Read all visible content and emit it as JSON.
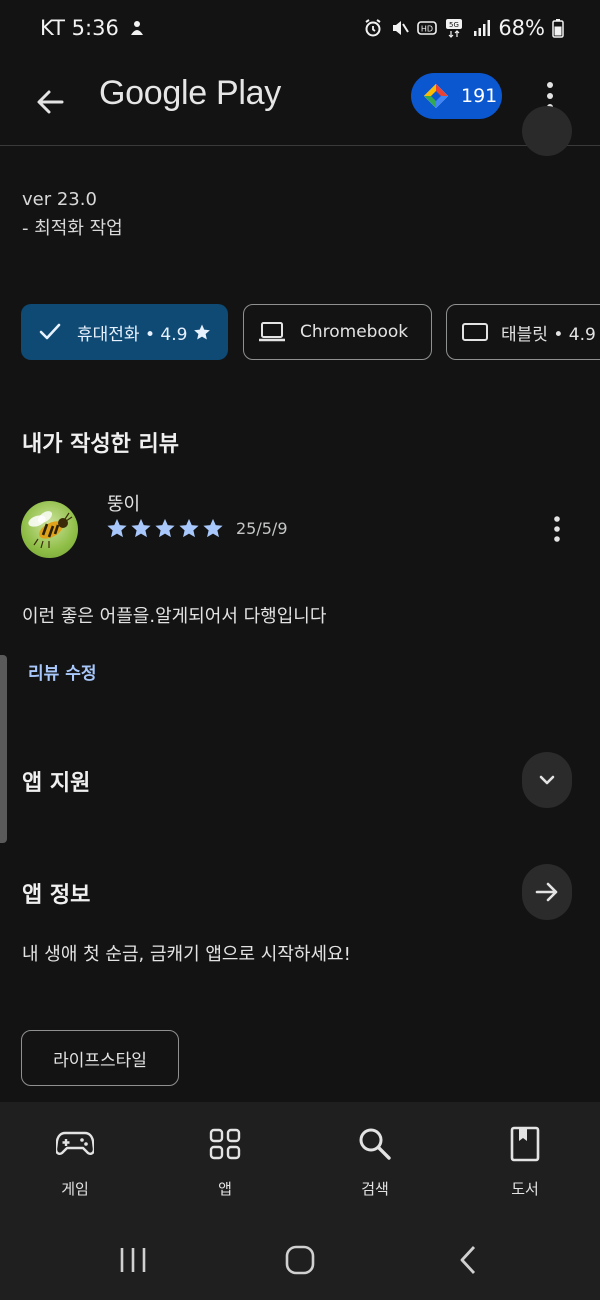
{
  "status_bar": {
    "carrier_time": "KT 5:36",
    "battery": "68%"
  },
  "app_bar": {
    "title": "Google Play",
    "points": "191",
    "points_brand_color": "#0b57d0"
  },
  "whats_new": {
    "version": "ver 23.0",
    "note": "- 최적화 작업"
  },
  "device_chips": [
    {
      "label": "휴대전화 • 4.9",
      "icon": "check-icon",
      "selected": true
    },
    {
      "label": "Chromebook",
      "icon": "laptop-icon",
      "selected": false
    },
    {
      "label": "태블릿 • 4.9",
      "icon": "tablet-icon",
      "selected": false
    }
  ],
  "my_review": {
    "heading": "내가 작성한 리뷰",
    "reviewer": "뚱이",
    "rating": 5,
    "date": "25/5/9",
    "text": "이런 좋은 어플을.알게되어서 다행입니다",
    "edit_label": "리뷰 수정"
  },
  "app_support": {
    "heading": "앱 지원"
  },
  "app_info": {
    "heading": "앱 정보",
    "description": "내 생애 첫 순금, 금캐기 앱으로 시작하세요!",
    "category": "라이프스타일"
  },
  "bottom_nav": [
    {
      "label": "게임",
      "icon": "gamepad-icon"
    },
    {
      "label": "앱",
      "icon": "apps-grid-icon"
    },
    {
      "label": "검색",
      "icon": "search-icon"
    },
    {
      "label": "도서",
      "icon": "book-icon"
    }
  ],
  "colors": {
    "background": "#131313",
    "selected_chip": "#0e4a74",
    "star": "#a8c7fa",
    "link": "#a8c7fa"
  }
}
